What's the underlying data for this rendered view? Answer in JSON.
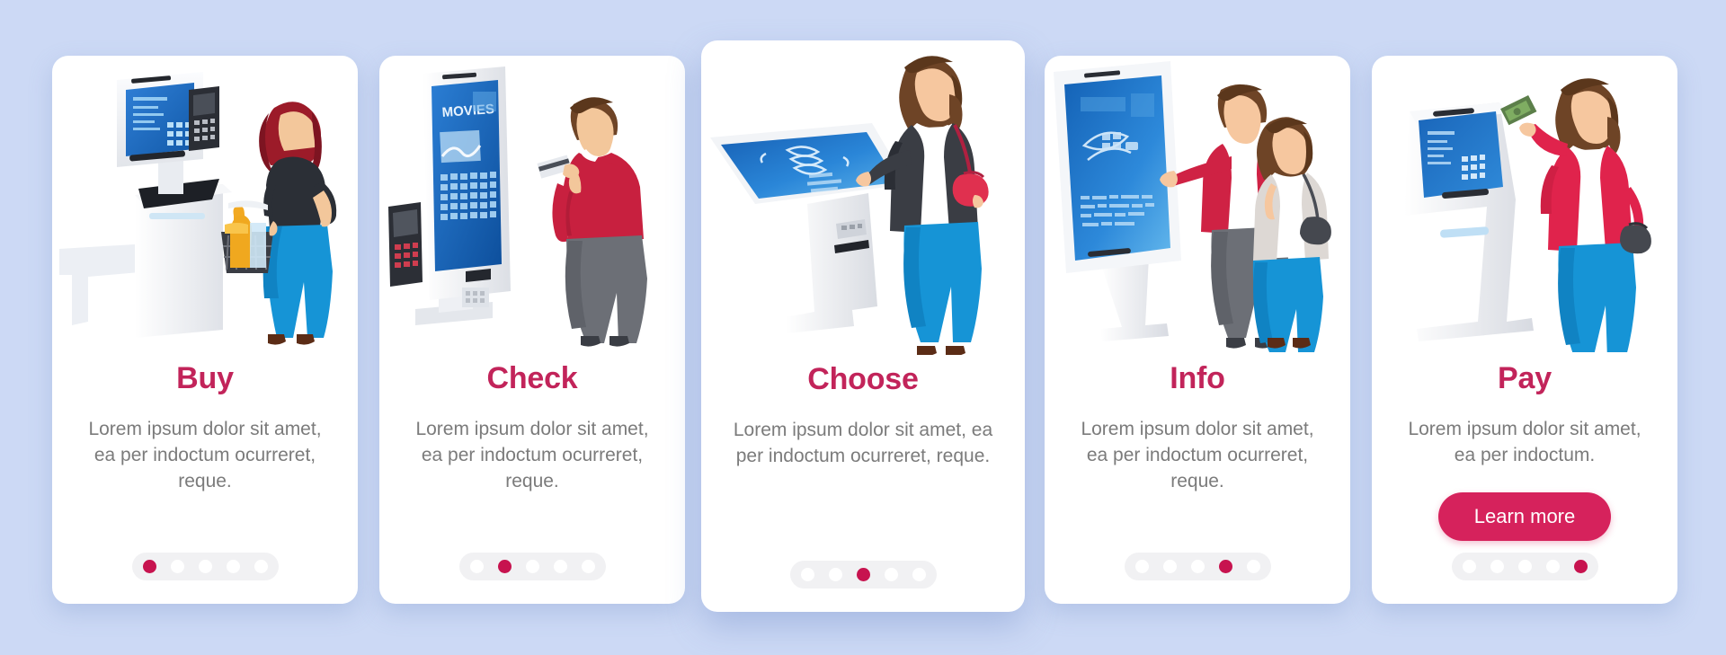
{
  "page": {
    "background_color": "#ccd9f5",
    "card_background": "#ffffff",
    "heading_color": "#c2245a",
    "body_color": "#7b7b7b",
    "accent_color": "#d6225c",
    "dot_active_color": "#c7134f",
    "dot_inactive_color": "#ffffff",
    "dot_track_color": "#f1f1f3",
    "total_steps": 5
  },
  "screens": [
    {
      "id": "buy",
      "heading": "Buy",
      "body": "Lorem ipsum dolor sit amet, ea per indoctum ocurreret, reque.",
      "illustration": "self-checkout-kiosk-woman-basket",
      "illustration_screen_label": "",
      "active_dot": 1,
      "cta": null
    },
    {
      "id": "check",
      "heading": "Check",
      "body": "Lorem ipsum dolor sit amet, ea per indoctum ocurreret, reque.",
      "illustration": "movie-ticket-kiosk-man-card",
      "illustration_screen_label": "MOVIES",
      "active_dot": 2,
      "cta": null
    },
    {
      "id": "choose",
      "heading": "Choose",
      "body": "Lorem ipsum dolor sit amet, ea per indoctum ocurreret, reque.",
      "illustration": "tilted-touch-table-kiosk-woman",
      "illustration_screen_label": "",
      "active_dot": 3,
      "cta": null
    },
    {
      "id": "info",
      "heading": "Info",
      "body": "Lorem ipsum dolor sit amet, ea per indoctum ocurreret, reque.",
      "illustration": "info-kiosk-couple-pointing",
      "illustration_screen_label": "",
      "active_dot": 4,
      "cta": null
    },
    {
      "id": "pay",
      "heading": "Pay",
      "body": "Lorem ipsum dolor sit amet, ea per indoctum.",
      "illustration": "payment-kiosk-woman-cash",
      "illustration_screen_label": "",
      "active_dot": 5,
      "cta": "Learn more"
    }
  ]
}
